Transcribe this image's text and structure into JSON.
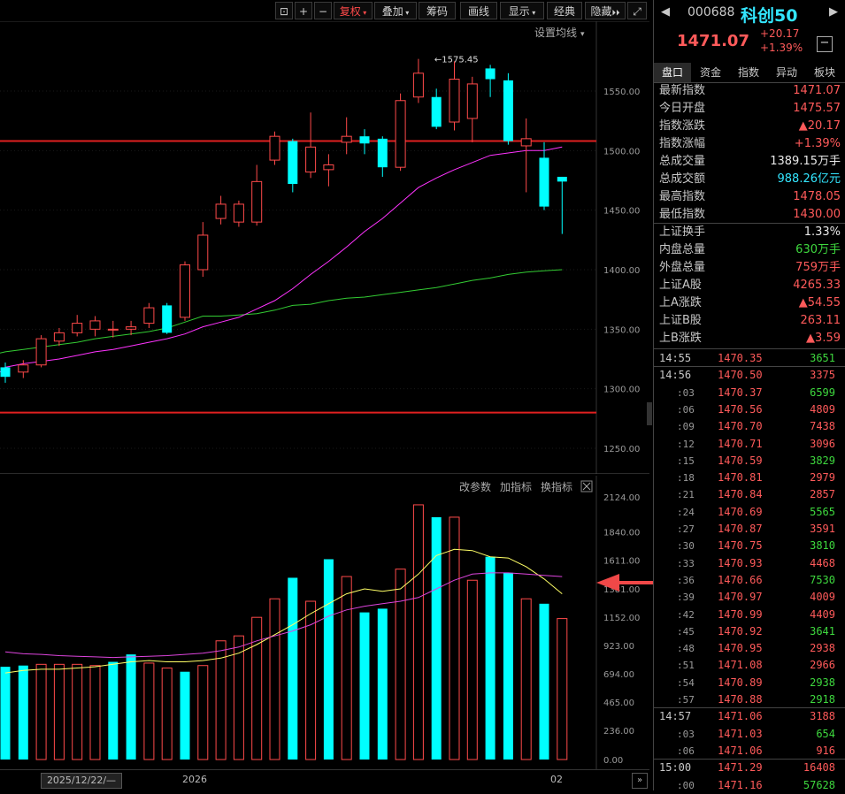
{
  "toolbar": {
    "buttons": [
      "复权",
      "叠加",
      "筹码",
      "画线",
      "显示",
      "经典",
      "隐藏"
    ],
    "ma_setting": "设置均线"
  },
  "main_chart": {
    "annotation": "1575.45",
    "h_lines": [
      1508,
      1280
    ]
  },
  "indicator_panel": {
    "links": [
      "改参数",
      "加指标",
      "换指标"
    ]
  },
  "chart_data": [
    {
      "type": "candlestick",
      "ylim": [
        1240,
        1620
      ],
      "yticks": [
        "1550.00",
        "1500.00",
        "1450.00",
        "1400.00",
        "1350.00",
        "1300.00",
        "1250.00"
      ],
      "candles": [
        {
          "o": 1318,
          "c": 1310,
          "h": 1322,
          "l": 1305
        },
        {
          "o": 1314,
          "c": 1320,
          "h": 1324,
          "l": 1309
        },
        {
          "o": 1320,
          "c": 1342,
          "h": 1345,
          "l": 1318
        },
        {
          "o": 1340,
          "c": 1347,
          "h": 1351,
          "l": 1336
        },
        {
          "o": 1347,
          "c": 1355,
          "h": 1362,
          "l": 1344
        },
        {
          "o": 1350,
          "c": 1357,
          "h": 1361,
          "l": 1344
        },
        {
          "o": 1350,
          "c": 1350,
          "h": 1357,
          "l": 1343
        },
        {
          "o": 1350,
          "c": 1352,
          "h": 1357,
          "l": 1345
        },
        {
          "o": 1355,
          "c": 1368,
          "h": 1372,
          "l": 1351
        },
        {
          "o": 1370,
          "c": 1347,
          "h": 1372,
          "l": 1346
        },
        {
          "o": 1360,
          "c": 1404,
          "h": 1407,
          "l": 1357
        },
        {
          "o": 1400,
          "c": 1429,
          "h": 1440,
          "l": 1394
        },
        {
          "o": 1443,
          "c": 1455,
          "h": 1462,
          "l": 1438
        },
        {
          "o": 1440,
          "c": 1455,
          "h": 1458,
          "l": 1436
        },
        {
          "o": 1440,
          "c": 1474,
          "h": 1488,
          "l": 1437
        },
        {
          "o": 1492,
          "c": 1512,
          "h": 1516,
          "l": 1488
        },
        {
          "o": 1508,
          "c": 1472,
          "h": 1510,
          "l": 1465
        },
        {
          "o": 1482,
          "c": 1503,
          "h": 1532,
          "l": 1477
        },
        {
          "o": 1484,
          "c": 1488,
          "h": 1497,
          "l": 1470
        },
        {
          "o": 1507,
          "c": 1512,
          "h": 1528,
          "l": 1497
        },
        {
          "o": 1512,
          "c": 1506,
          "h": 1518,
          "l": 1497
        },
        {
          "o": 1510,
          "c": 1486,
          "h": 1512,
          "l": 1478
        },
        {
          "o": 1486,
          "c": 1542,
          "h": 1548,
          "l": 1483
        },
        {
          "o": 1545,
          "c": 1565,
          "h": 1577,
          "l": 1540
        },
        {
          "o": 1545,
          "c": 1520,
          "h": 1552,
          "l": 1518
        },
        {
          "o": 1524,
          "c": 1560,
          "h": 1575,
          "l": 1517
        },
        {
          "o": 1527,
          "c": 1556,
          "h": 1562,
          "l": 1507
        },
        {
          "o": 1569,
          "c": 1560,
          "h": 1572,
          "l": 1545
        },
        {
          "o": 1559,
          "c": 1508,
          "h": 1565,
          "l": 1505
        },
        {
          "o": 1504,
          "c": 1510,
          "h": 1527,
          "l": 1465
        },
        {
          "o": 1494,
          "c": 1453,
          "h": 1507,
          "l": 1450
        },
        {
          "o": 1478,
          "c": 1474,
          "h": 1478,
          "l": 1430
        }
      ],
      "ma_slow": [
        1331,
        1333,
        1335,
        1337,
        1339,
        1342,
        1344,
        1346,
        1348,
        1351,
        1356,
        1361,
        1361,
        1362,
        1363,
        1366,
        1370,
        1371,
        1374,
        1376,
        1377,
        1379,
        1381,
        1383,
        1385,
        1388,
        1391,
        1393,
        1396,
        1398,
        1399,
        1400
      ],
      "ma_fast": [
        1318,
        1321,
        1323,
        1325,
        1328,
        1331,
        1333,
        1336,
        1339,
        1342,
        1346,
        1352,
        1356,
        1360,
        1367,
        1374,
        1384,
        1396,
        1407,
        1419,
        1432,
        1443,
        1456,
        1469,
        1477,
        1484,
        1490,
        1496,
        1498,
        1500,
        1500,
        1503
      ]
    },
    {
      "type": "bar",
      "ylim": [
        0,
        2124
      ],
      "yticks": [
        "2124.00",
        "1840.00",
        "1611.00",
        "1381.00",
        "1152.00",
        "923.00",
        "694.00",
        "465.00",
        "236.00",
        "0.00"
      ],
      "values": [
        750,
        760,
        770,
        770,
        770,
        760,
        790,
        850,
        780,
        740,
        710,
        760,
        960,
        1000,
        1150,
        1300,
        1470,
        1280,
        1620,
        1480,
        1190,
        1220,
        1540,
        2060,
        1960,
        1960,
        1450,
        1640,
        1510,
        1300,
        1260,
        1140
      ],
      "up": [
        0,
        0,
        1,
        1,
        1,
        1,
        0,
        0,
        1,
        1,
        0,
        1,
        1,
        1,
        1,
        1,
        0,
        1,
        0,
        1,
        0,
        0,
        1,
        1,
        0,
        1,
        1,
        0,
        0,
        1,
        0,
        1
      ],
      "ma5": [
        700,
        720,
        730,
        730,
        740,
        750,
        770,
        790,
        800,
        790,
        790,
        800,
        820,
        860,
        930,
        1010,
        1090,
        1180,
        1260,
        1340,
        1380,
        1360,
        1380,
        1500,
        1650,
        1700,
        1690,
        1640,
        1630,
        1560,
        1460,
        1340
      ],
      "ma10": [
        870,
        855,
        850,
        840,
        835,
        830,
        825,
        830,
        835,
        840,
        850,
        860,
        880,
        910,
        960,
        1000,
        1040,
        1090,
        1160,
        1210,
        1240,
        1260,
        1280,
        1310,
        1380,
        1450,
        1500,
        1510,
        1510,
        1500,
        1490,
        1480
      ]
    }
  ],
  "date_axis": [
    "2025/12/22/—",
    "2026",
    "02"
  ],
  "quote": {
    "code": "000688",
    "name": "科创50",
    "price": "1471.07",
    "change": "+20.17",
    "change_pct": "+1.39%"
  },
  "tabs": [
    "盘口",
    "资金",
    "指数",
    "异动",
    "板块"
  ],
  "stats": [
    {
      "k": "最新指数",
      "v": "1471.07",
      "c": "red"
    },
    {
      "k": "今日开盘",
      "v": "1475.57",
      "c": "red"
    },
    {
      "k": "指数涨跌",
      "v": "▲20.17",
      "c": "red"
    },
    {
      "k": "指数涨幅",
      "v": "+1.39%",
      "c": "red"
    },
    {
      "k": "总成交量",
      "v": "1389.15万手",
      "c": "white"
    },
    {
      "k": "总成交额",
      "v": "988.26亿元",
      "c": "cyan"
    },
    {
      "k": "最高指数",
      "v": "1478.05",
      "c": "red"
    },
    {
      "k": "最低指数",
      "v": "1430.00",
      "c": "red"
    }
  ],
  "stats2": [
    {
      "k": "上证换手",
      "v": "1.33%",
      "c": "white"
    },
    {
      "k": "内盘总量",
      "v": "630万手",
      "c": "green"
    },
    {
      "k": "外盘总量",
      "v": "759万手",
      "c": "red"
    },
    {
      "k": "上证A股",
      "v": "4265.33",
      "c": "red"
    },
    {
      "k": "上A涨跌",
      "v": "▲54.55",
      "c": "red"
    },
    {
      "k": "上证B股",
      "v": "263.11",
      "c": "red"
    },
    {
      "k": "上B涨跌",
      "v": "▲3.59",
      "c": "red"
    }
  ],
  "ticks": [
    {
      "t": "14:55",
      "p": "1470.35",
      "q": "3651",
      "c": "green",
      "sub": false
    },
    {
      "t": "14:56",
      "p": "1470.50",
      "q": "3375",
      "c": "red",
      "sub": false
    },
    {
      "t": ":03",
      "p": "1470.37",
      "q": "6599",
      "c": "green",
      "sub": true
    },
    {
      "t": ":06",
      "p": "1470.56",
      "q": "4809",
      "c": "red",
      "sub": true
    },
    {
      "t": ":09",
      "p": "1470.70",
      "q": "7438",
      "c": "red",
      "sub": true
    },
    {
      "t": ":12",
      "p": "1470.71",
      "q": "3096",
      "c": "red",
      "sub": true
    },
    {
      "t": ":15",
      "p": "1470.59",
      "q": "3829",
      "c": "green",
      "sub": true
    },
    {
      "t": ":18",
      "p": "1470.81",
      "q": "2979",
      "c": "red",
      "sub": true
    },
    {
      "t": ":21",
      "p": "1470.84",
      "q": "2857",
      "c": "red",
      "sub": true
    },
    {
      "t": ":24",
      "p": "1470.69",
      "q": "5565",
      "c": "green",
      "sub": true
    },
    {
      "t": ":27",
      "p": "1470.87",
      "q": "3591",
      "c": "red",
      "sub": true
    },
    {
      "t": ":30",
      "p": "1470.75",
      "q": "3810",
      "c": "green",
      "sub": true
    },
    {
      "t": ":33",
      "p": "1470.93",
      "q": "4468",
      "c": "red",
      "sub": true
    },
    {
      "t": ":36",
      "p": "1470.66",
      "q": "7530",
      "c": "green",
      "sub": true
    },
    {
      "t": ":39",
      "p": "1470.97",
      "q": "4009",
      "c": "red",
      "sub": true
    },
    {
      "t": ":42",
      "p": "1470.99",
      "q": "4409",
      "c": "red",
      "sub": true
    },
    {
      "t": ":45",
      "p": "1470.92",
      "q": "3641",
      "c": "green",
      "sub": true
    },
    {
      "t": ":48",
      "p": "1470.95",
      "q": "2938",
      "c": "red",
      "sub": true
    },
    {
      "t": ":51",
      "p": "1471.08",
      "q": "2966",
      "c": "red",
      "sub": true
    },
    {
      "t": ":54",
      "p": "1470.89",
      "q": "2938",
      "c": "green",
      "sub": true
    },
    {
      "t": ":57",
      "p": "1470.88",
      "q": "2918",
      "c": "green",
      "sub": true
    },
    {
      "t": "14:57",
      "p": "1471.06",
      "q": "3188",
      "c": "red",
      "sub": false
    },
    {
      "t": ":03",
      "p": "1471.03",
      "q": "654",
      "c": "green",
      "sub": true
    },
    {
      "t": ":06",
      "p": "1471.06",
      "q": "916",
      "c": "red",
      "sub": true
    },
    {
      "t": "15:00",
      "p": "1471.29",
      "q": "16408",
      "c": "red",
      "sub": false
    },
    {
      "t": ":00",
      "p": "1471.16",
      "q": "57628",
      "c": "green",
      "sub": true
    }
  ],
  "colors": {
    "up": "#ff4a4a",
    "down": "#00ffff",
    "ma_slow": "#33cc33",
    "ma_fast": "#ff33ff",
    "vol_ma5": "#ffff66",
    "vol_ma10": "#dd44dd"
  }
}
